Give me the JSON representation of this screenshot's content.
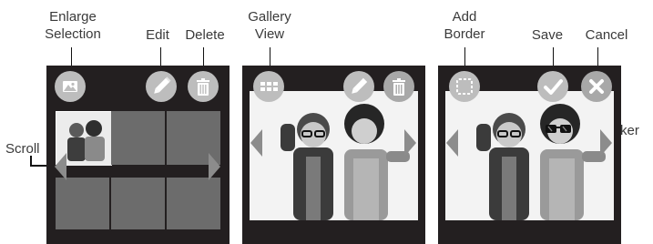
{
  "labels": {
    "enlarge_line1": "Enlarge",
    "enlarge_line2": "Selection",
    "edit": "Edit",
    "delete": "Delete",
    "scroll": "Scroll",
    "gallery_line1": "Gallery",
    "gallery_line2": "View",
    "add_line1": "Add",
    "add_line2": "Border",
    "save": "Save",
    "cancel": "Cancel",
    "sticker": "Sticker"
  },
  "icons": {
    "screen1": [
      "image-icon",
      "pencil-icon",
      "trash-icon"
    ],
    "screen2": [
      "grid-icon",
      "pencil-icon",
      "trash-icon"
    ],
    "screen3": [
      "border-icon",
      "checkmark-icon",
      "close-icon"
    ]
  },
  "colors": {
    "screen_bg": "#231f20",
    "button_bg": "#bdbdbd",
    "tile": "#6c6c6c",
    "arrow": "#8c8c8c",
    "label_text": "#3a3a3a"
  }
}
